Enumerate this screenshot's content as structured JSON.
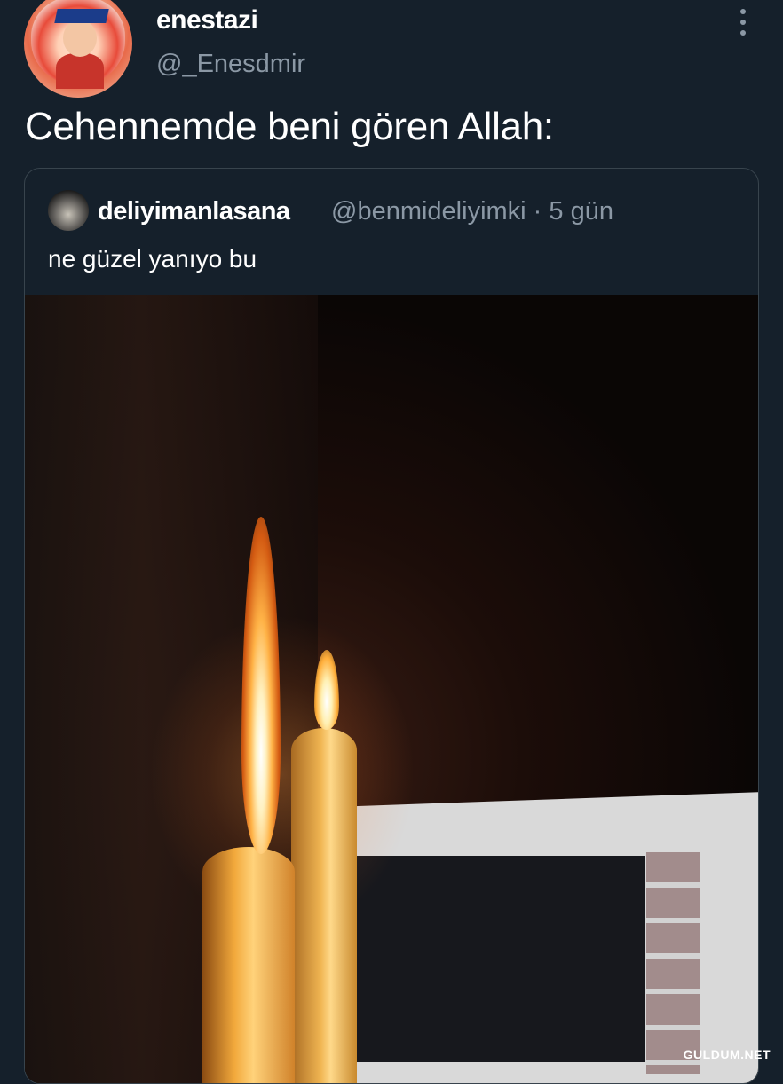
{
  "author": {
    "display_name": "enestazi",
    "handle": "@_Enesdmir"
  },
  "tweet": {
    "text": "Cehennemde beni gören Allah:"
  },
  "quoted_tweet": {
    "display_name": "deliyimanlasana",
    "meta": "@benmideliyimki · 5 gün",
    "text": "ne güzel yanıyo bu"
  },
  "watermark": "GULDUM.NET",
  "icons": {
    "more": "more-vertical-icon"
  },
  "colors": {
    "background": "#15202b",
    "secondary_text": "#8b98a5",
    "border": "#38444d"
  }
}
